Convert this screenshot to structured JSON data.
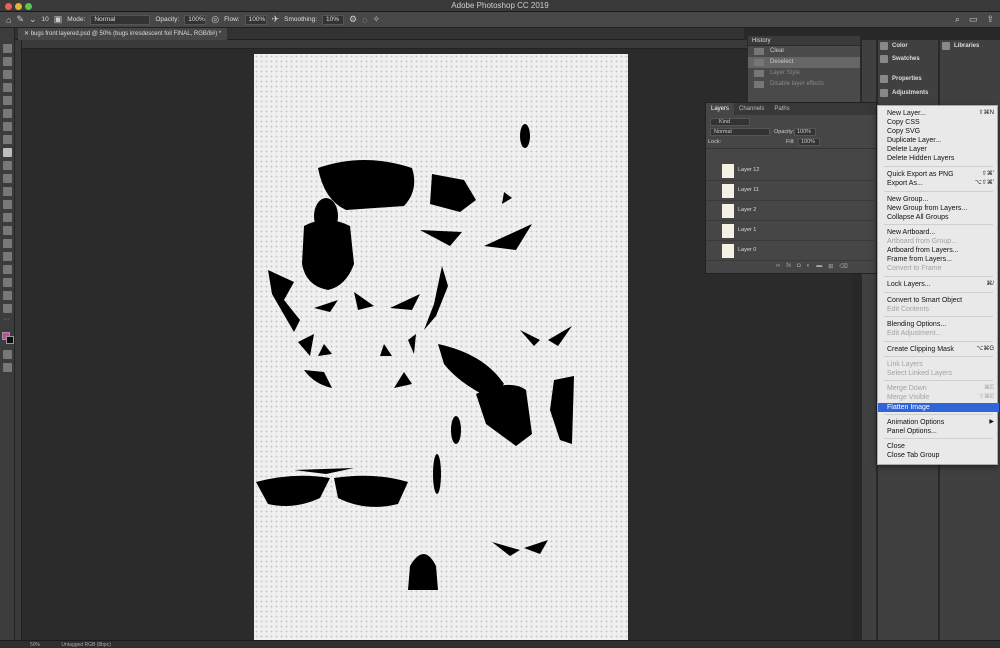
{
  "window": {
    "title": "Adobe Photoshop CC 2019"
  },
  "options_bar": {
    "brush_size": "10",
    "mode_label": "Mode:",
    "mode_value": "Normal",
    "opacity_label": "Opacity:",
    "opacity_value": "100%",
    "flow_label": "Flow:",
    "flow_value": "100%",
    "smoothing_label": "Smoothing:",
    "smoothing_value": "10%"
  },
  "document_tab": {
    "label": "bugs front layered.psd @ 50% (bugs irresdescent foil FINAL, RGB/8#) *"
  },
  "status_bar": {
    "zoom": "50%",
    "profile": "Untagged RGB (8bpc)"
  },
  "history_panel": {
    "title": "History",
    "items": [
      {
        "label": "Clear",
        "state": "normal"
      },
      {
        "label": "Deselect",
        "state": "selected"
      },
      {
        "label": "Layer Style",
        "state": "dim"
      },
      {
        "label": "Disable layer effects",
        "state": "dim"
      }
    ]
  },
  "dock": {
    "color": "Color",
    "swatches": "Swatches",
    "properties": "Properties",
    "adjustments": "Adjustments",
    "libraries": "Libraries"
  },
  "layers_panel": {
    "tabs": [
      "Layers",
      "Channels",
      "Paths"
    ],
    "filter_label": "Kind",
    "blend_mode": "Normal",
    "opacity_label": "Opacity:",
    "opacity_value": "100%",
    "lock_label": "Lock:",
    "fill_label": "Fill:",
    "fill_value": "100%",
    "layers": [
      "Layer 12",
      "Layer 11",
      "Layer 2",
      "Layer 1",
      "Layer 0"
    ]
  },
  "context_menu": {
    "items": [
      {
        "label": "New Layer...",
        "shortcut": "⇧⌘N",
        "enabled": true
      },
      {
        "label": "Copy CSS",
        "shortcut": "",
        "enabled": true
      },
      {
        "label": "Copy SVG",
        "shortcut": "",
        "enabled": true
      },
      {
        "label": "Duplicate Layer...",
        "shortcut": "",
        "enabled": true
      },
      {
        "label": "Delete Layer",
        "shortcut": "",
        "enabled": true
      },
      {
        "label": "Delete Hidden Layers",
        "shortcut": "",
        "enabled": true
      },
      {
        "label": "Quick Export as PNG",
        "shortcut": "⇧⌘'",
        "enabled": true
      },
      {
        "label": "Export As...",
        "shortcut": "⌥⇧⌘'",
        "enabled": true
      },
      {
        "label": "New Group...",
        "shortcut": "",
        "enabled": true
      },
      {
        "label": "New Group from Layers...",
        "shortcut": "",
        "enabled": true
      },
      {
        "label": "Collapse All Groups",
        "shortcut": "",
        "enabled": true
      },
      {
        "label": "New Artboard...",
        "shortcut": "",
        "enabled": true
      },
      {
        "label": "Artboard from Group...",
        "shortcut": "",
        "enabled": false
      },
      {
        "label": "Artboard from Layers...",
        "shortcut": "",
        "enabled": true
      },
      {
        "label": "Frame from Layers...",
        "shortcut": "",
        "enabled": true
      },
      {
        "label": "Convert to Frame",
        "shortcut": "",
        "enabled": false
      },
      {
        "label": "Lock Layers...",
        "shortcut": "⌘/",
        "enabled": true
      },
      {
        "label": "Convert to Smart Object",
        "shortcut": "",
        "enabled": true
      },
      {
        "label": "Edit Contents",
        "shortcut": "",
        "enabled": false
      },
      {
        "label": "Blending Options...",
        "shortcut": "",
        "enabled": true
      },
      {
        "label": "Edit Adjustment...",
        "shortcut": "",
        "enabled": false
      },
      {
        "label": "Create Clipping Mask",
        "shortcut": "⌥⌘G",
        "enabled": true
      },
      {
        "label": "Link Layers",
        "shortcut": "",
        "enabled": false
      },
      {
        "label": "Select Linked Layers",
        "shortcut": "",
        "enabled": false
      },
      {
        "label": "Merge Down",
        "shortcut": "⌘E",
        "enabled": false
      },
      {
        "label": "Merge Visible",
        "shortcut": "⇧⌘E",
        "enabled": false
      },
      {
        "label": "Flatten Image",
        "shortcut": "",
        "enabled": true,
        "highlighted": true
      },
      {
        "label": "Animation Options",
        "shortcut": "▶",
        "enabled": true
      },
      {
        "label": "Panel Options...",
        "shortcut": "",
        "enabled": true
      },
      {
        "label": "Close",
        "shortcut": "",
        "enabled": true
      },
      {
        "label": "Close Tab Group",
        "shortcut": "",
        "enabled": true
      }
    ]
  },
  "colors": {
    "foreground": "#d63fb0",
    "background": "#111111",
    "menu_highlight": "#2f65d9"
  }
}
